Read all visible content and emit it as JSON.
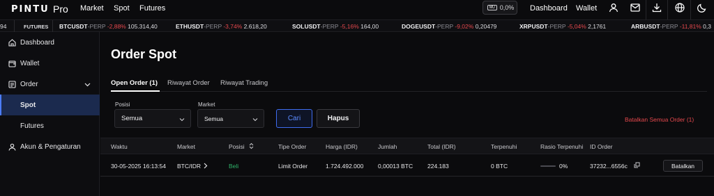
{
  "brand": {
    "logo": "PINTU",
    "pro": "Pro"
  },
  "topnav": [
    "Market",
    "Spot",
    "Futures"
  ],
  "mode": {
    "badge": "MU",
    "value": "0,0%"
  },
  "topright": {
    "dashboard": "Dashboard",
    "wallet": "Wallet"
  },
  "ticker": {
    "label": "FUTURES",
    "lead": "94",
    "items": [
      {
        "sym": "BTCUSDT",
        "perp": "-PERP",
        "chg": "-2,88%",
        "price": "105.314,40"
      },
      {
        "sym": "ETHUSDT",
        "perp": "-PERP",
        "chg": "-3,74%",
        "price": "2.618,20"
      },
      {
        "sym": "SOLUSDT",
        "perp": "-PERP",
        "chg": "-5,16%",
        "price": "164,00"
      },
      {
        "sym": "DOGEUSDT",
        "perp": "-PERP",
        "chg": "-9,02%",
        "price": "0,20479"
      },
      {
        "sym": "XRPUSDT",
        "perp": "-PERP",
        "chg": "-5,04%",
        "price": "2,1761"
      },
      {
        "sym": "ARBUSDT",
        "perp": "-PERP",
        "chg": "-11,81%",
        "price": "0,3"
      }
    ]
  },
  "sidebar": {
    "items": [
      {
        "label": "Dashboard"
      },
      {
        "label": "Wallet"
      },
      {
        "label": "Order"
      },
      {
        "label": "Spot"
      },
      {
        "label": "Futures"
      },
      {
        "label": "Akun & Pengaturan"
      }
    ]
  },
  "main": {
    "title": "Order Spot",
    "tabs": [
      {
        "label": "Open Order (1)"
      },
      {
        "label": "Riwayat Order"
      },
      {
        "label": "Riwayat Trading"
      }
    ],
    "filters": {
      "posisi_label": "Posisi",
      "posisi_value": "Semua",
      "market_label": "Market",
      "market_value": "Semua",
      "cari": "Cari",
      "hapus": "Hapus",
      "cancel_all": "Batalkan Semua Order (1)"
    },
    "columns": [
      "Waktu",
      "Market",
      "Posisi",
      "Tipe Order",
      "Harga (IDR)",
      "Jumlah",
      "Total (IDR)",
      "Terpenuhi",
      "Rasio Terpenuhi",
      "ID Order"
    ],
    "rows": [
      {
        "waktu": "30-05-2025 16:13:54",
        "market": "BTC/IDR",
        "posisi": "Beli",
        "tipe": "Limit Order",
        "harga": "1.724.492.000",
        "jumlah": "0,00013 BTC",
        "total": "224.183",
        "terpenuhi": "0 BTC",
        "rasio_value": 0,
        "rasio": "0%",
        "id": "37232...6556c",
        "action": "Batalkan"
      }
    ]
  },
  "colors": {
    "accent": "#4c7dff",
    "negative": "#e5484d",
    "positive": "#2fb36a",
    "bg": "#0b0b0d"
  }
}
